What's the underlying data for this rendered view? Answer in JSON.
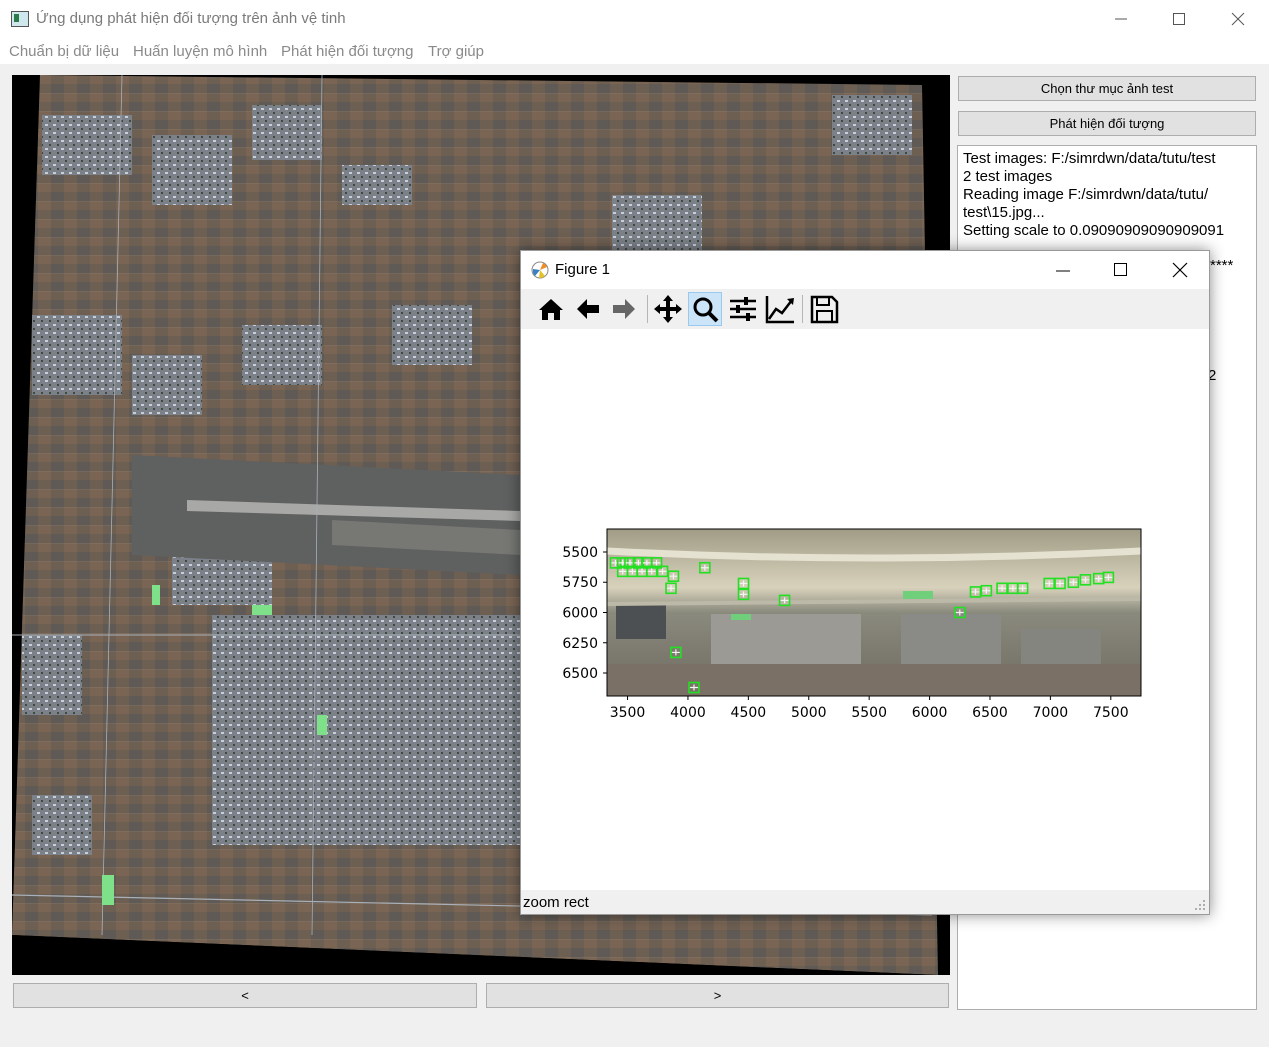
{
  "window": {
    "title": "Ứng dụng phát hiện đối tượng trên ảnh vệ tinh",
    "icon": "app-icon"
  },
  "menu": [
    "Chuẩn bị dữ liệu",
    "Huấn luyện mô hình",
    "Phát hiện đối tượng",
    "Trợ giúp"
  ],
  "sidebar": {
    "choose_folder_label": "Chọn thư mục ảnh test",
    "detect_label": "Phát hiện đối tượng"
  },
  "log": {
    "lines": [
      "Test images: F:/simrdwn/data/tutu/test",
      "2 test images",
      "Reading image F:/simrdwn/data/tutu/",
      "test\\15.jpg...",
      "Setting scale to 0.09090909090909091"
    ],
    "partial_stars": "****",
    "partial_digit": "2"
  },
  "nav": {
    "prev_label": "<",
    "next_label": ">"
  },
  "figure": {
    "title": "Figure 1",
    "status": "zoom rect",
    "toolbar": [
      "home-icon",
      "back-icon",
      "forward-icon",
      "pan-icon",
      "zoom-icon",
      "configure-subplots-icon",
      "edit-axis-icon",
      "save-icon"
    ],
    "active_tool": "zoom-icon"
  },
  "chart_data": {
    "type": "image",
    "xticks": [
      3500,
      4000,
      4500,
      5000,
      5500,
      6000,
      6500,
      7000,
      7500
    ],
    "yticks": [
      5500,
      5750,
      6000,
      6250,
      6500
    ],
    "xlim": [
      3330,
      7750
    ],
    "ylim": [
      6690,
      5310
    ],
    "xlabel": "",
    "ylabel": "",
    "title": "",
    "detections": [
      {
        "x": 3400,
        "y": 5590
      },
      {
        "x": 3460,
        "y": 5590
      },
      {
        "x": 3520,
        "y": 5590
      },
      {
        "x": 3590,
        "y": 5590
      },
      {
        "x": 3660,
        "y": 5590
      },
      {
        "x": 3740,
        "y": 5590
      },
      {
        "x": 3460,
        "y": 5660
      },
      {
        "x": 3540,
        "y": 5660
      },
      {
        "x": 3620,
        "y": 5660
      },
      {
        "x": 3700,
        "y": 5660
      },
      {
        "x": 3790,
        "y": 5660
      },
      {
        "x": 3880,
        "y": 5700
      },
      {
        "x": 3860,
        "y": 5800
      },
      {
        "x": 4140,
        "y": 5630
      },
      {
        "x": 4460,
        "y": 5760
      },
      {
        "x": 4460,
        "y": 5850
      },
      {
        "x": 4800,
        "y": 5900
      },
      {
        "x": 6250,
        "y": 6000
      },
      {
        "x": 6380,
        "y": 5830
      },
      {
        "x": 6470,
        "y": 5820
      },
      {
        "x": 6600,
        "y": 5800
      },
      {
        "x": 6690,
        "y": 5800
      },
      {
        "x": 6770,
        "y": 5800
      },
      {
        "x": 6990,
        "y": 5760
      },
      {
        "x": 7080,
        "y": 5760
      },
      {
        "x": 7190,
        "y": 5750
      },
      {
        "x": 7290,
        "y": 5730
      },
      {
        "x": 7400,
        "y": 5720
      },
      {
        "x": 7480,
        "y": 5710
      },
      {
        "x": 3900,
        "y": 6330
      },
      {
        "x": 4050,
        "y": 6620
      }
    ]
  }
}
